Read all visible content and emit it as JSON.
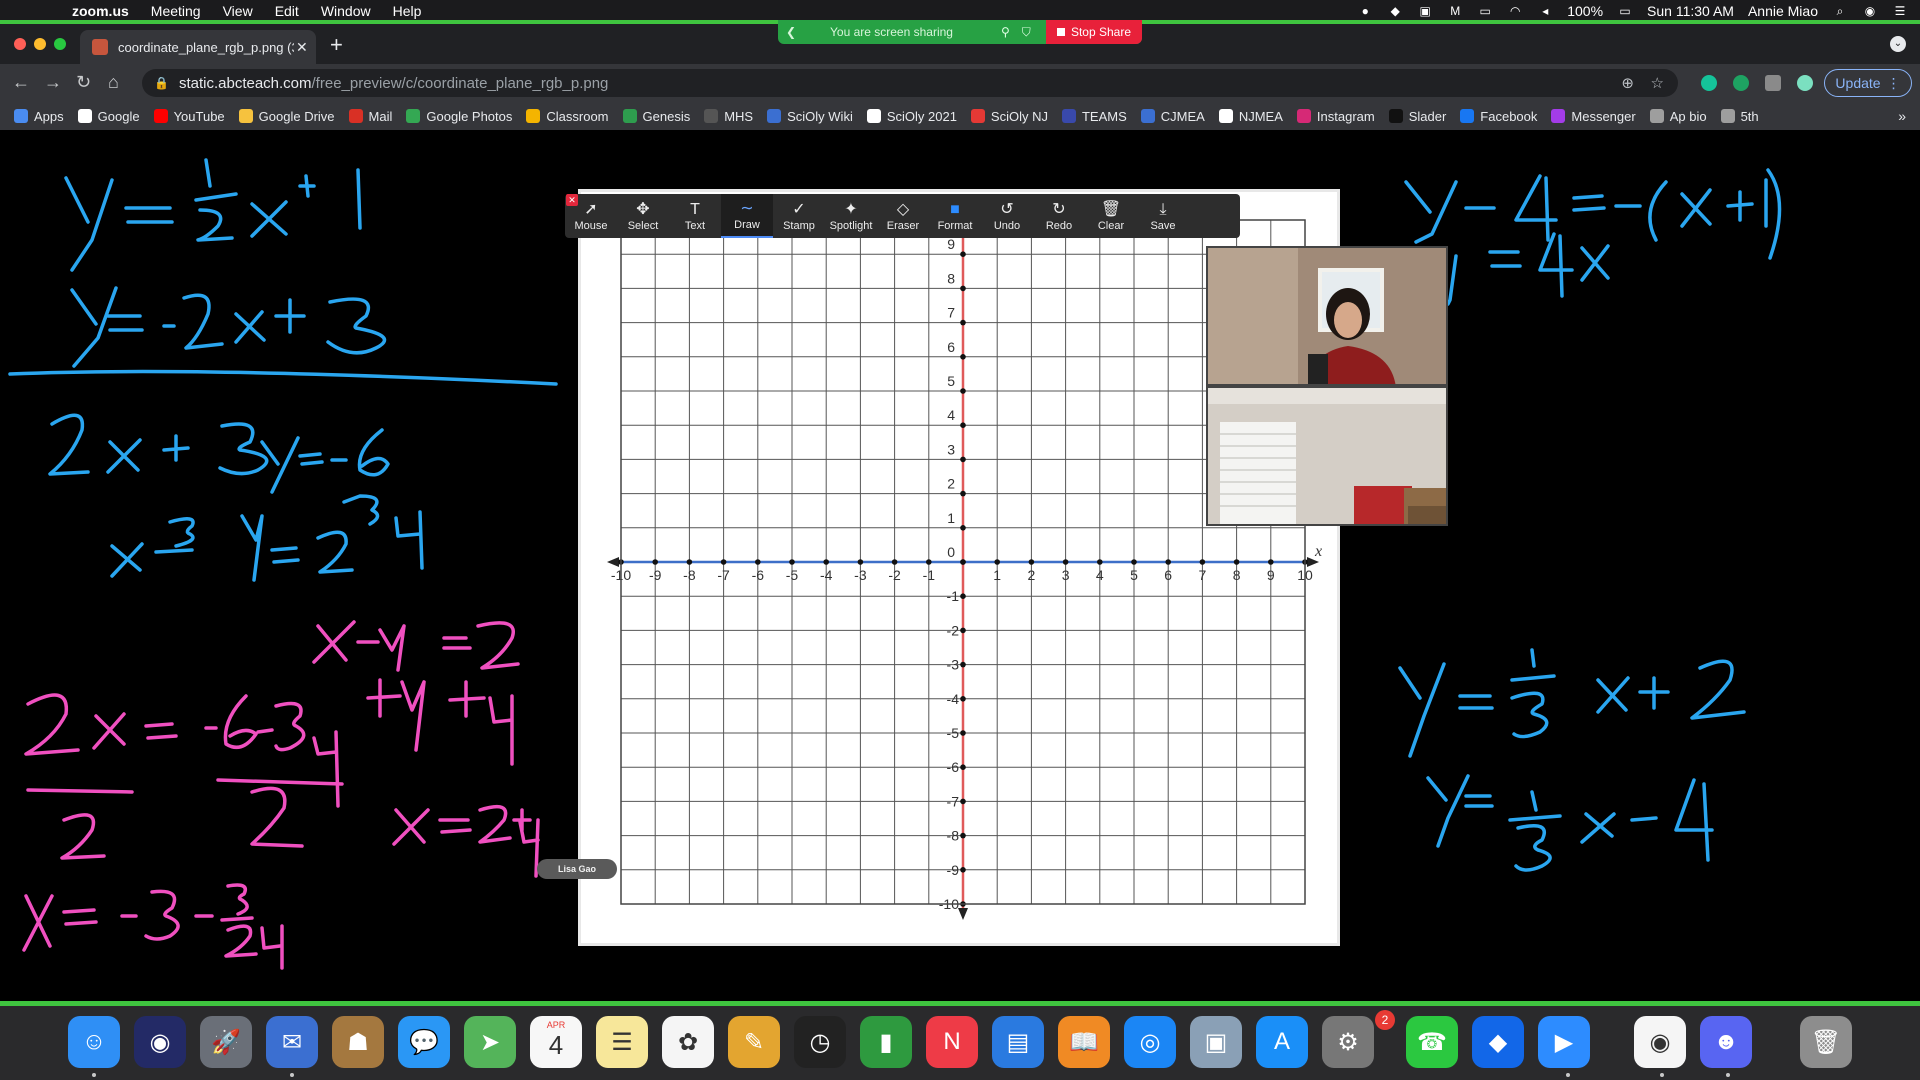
{
  "menubar": {
    "app": "zoom.us",
    "items": [
      "Meeting",
      "View",
      "Edit",
      "Window",
      "Help"
    ],
    "battery": "100%",
    "datetime": "Sun 11:30 AM",
    "user": "Annie Miao"
  },
  "share_banner": {
    "label": "You are screen sharing",
    "stop_label": "Stop Share"
  },
  "browser": {
    "tab_title": "coordinate_plane_rgb_p.png (3",
    "url_host": "static.abcteach.com",
    "url_path": "/free_preview/c/coordinate_plane_rgb_p.png",
    "update_label": "Update",
    "bookmarks": [
      {
        "label": "Apps",
        "color": "#4a8cf0"
      },
      {
        "label": "Google",
        "color": "#ffffff"
      },
      {
        "label": "YouTube",
        "color": "#ff0000"
      },
      {
        "label": "Google Drive",
        "color": "#f6c23e"
      },
      {
        "label": "Mail",
        "color": "#d93025"
      },
      {
        "label": "Google Photos",
        "color": "#34a853"
      },
      {
        "label": "Classroom",
        "color": "#f4b400"
      },
      {
        "label": "Genesis",
        "color": "#2e9d4e"
      },
      {
        "label": "MHS",
        "color": "#555555"
      },
      {
        "label": "SciOly Wiki",
        "color": "#3b6fd1"
      },
      {
        "label": "SciOly 2021",
        "color": "#ffffff"
      },
      {
        "label": "SciOly NJ",
        "color": "#e53935"
      },
      {
        "label": "TEAMS",
        "color": "#3949ab"
      },
      {
        "label": "CJMEA",
        "color": "#3b6fd1"
      },
      {
        "label": "NJMEA",
        "color": "#ffffff"
      },
      {
        "label": "Instagram",
        "color": "#d62976"
      },
      {
        "label": "Slader",
        "color": "#111111"
      },
      {
        "label": "Facebook",
        "color": "#1877f2"
      },
      {
        "label": "Messenger",
        "color": "#a33ce8"
      },
      {
        "label": "Ap bio",
        "color": "#9e9e9e"
      },
      {
        "label": "5th",
        "color": "#9e9e9e"
      }
    ]
  },
  "annotate": {
    "tools": [
      "Mouse",
      "Select",
      "Text",
      "Draw",
      "Stamp",
      "Spotlight",
      "Eraser",
      "Format",
      "Undo",
      "Redo",
      "Clear",
      "Save"
    ],
    "active": "Draw"
  },
  "graph": {
    "axis_label": "x",
    "x_ticks": [
      "-10",
      "-9",
      "-8",
      "-7",
      "-6",
      "-5",
      "-4",
      "-3",
      "-2",
      "-1",
      "1",
      "2",
      "3",
      "4",
      "5",
      "6",
      "7",
      "8",
      "9",
      "10"
    ],
    "y_ticks_pos": [
      "9",
      "8",
      "7",
      "6",
      "5",
      "4",
      "3",
      "2",
      "1",
      "0"
    ],
    "y_ticks_neg": [
      "-1",
      "-2",
      "-3",
      "-4",
      "-5",
      "-6",
      "-7",
      "-8",
      "-9",
      "-10"
    ]
  },
  "participant_name": "Lisa Gao",
  "colors": {
    "blue_ink": "#2aa6f0",
    "pink_ink": "#f050c0",
    "share_green": "#3fc43f",
    "stop_red": "#e8213a"
  },
  "dock": {
    "calendar_month": "APR",
    "calendar_day": "4",
    "badge": "2",
    "apps": [
      "finder",
      "siri",
      "launchpad",
      "mail-bird",
      "contacts",
      "messages",
      "maps",
      "calendar",
      "notes",
      "photos",
      "keynote-doc",
      "clock",
      "numbers",
      "news",
      "keynote",
      "books",
      "safari",
      "preview",
      "app-store",
      "system-preferences",
      "facetime",
      "dropbox",
      "zoom",
      "chrome",
      "discord",
      "trash"
    ]
  }
}
